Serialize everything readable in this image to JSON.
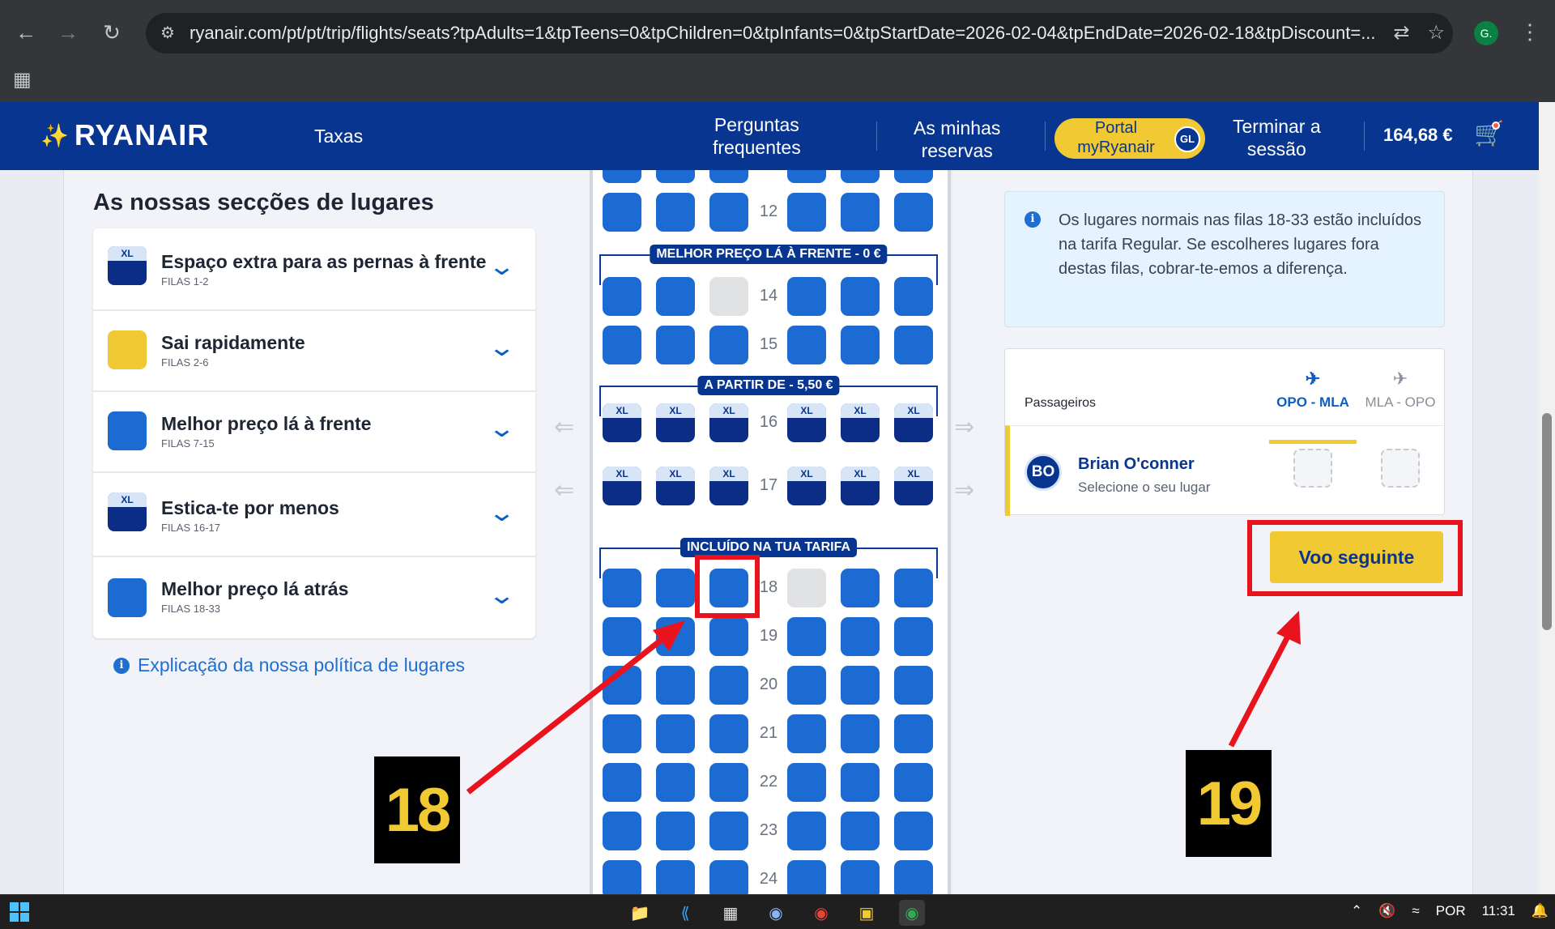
{
  "browser": {
    "url": "ryanair.com/pt/pt/trip/flights/seats?tpAdults=1&tpTeens=0&tpChildren=0&tpInfants=0&tpStartDate=2026-02-04&tpEndDate=2026-02-18&tpDiscount=...",
    "profile_initial": "G."
  },
  "header": {
    "logo": "RYANAIR",
    "taxes": "Taxas",
    "faq_line1": "Perguntas",
    "faq_line2": "frequentes",
    "bookings_line1": "As minhas",
    "bookings_line2": "reservas",
    "portal_line1": "Portal",
    "portal_line2": "myRyanair",
    "portal_badge": "GL",
    "logout_line1": "Terminar a",
    "logout_line2": "sessão",
    "total": "164,68 €"
  },
  "sections": {
    "title": "As nossas secções de lugares",
    "items": [
      {
        "name": "Espaço extra para as pernas à frente",
        "rows": "FILAS 1-2",
        "color": "#0c2d86",
        "badge": "XL"
      },
      {
        "name": "Sai rapidamente",
        "rows": "FILAS 2-6",
        "color": "#f1c933",
        "badge": ""
      },
      {
        "name": "Melhor preço lá à frente",
        "rows": "FILAS 7-15",
        "color": "#1b6bd2",
        "badge": ""
      },
      {
        "name": "Estica-te por menos",
        "rows": "FILAS 16-17",
        "color": "#0c2d86",
        "badge": "XL"
      },
      {
        "name": "Melhor preço lá atrás",
        "rows": "FILAS 18-33",
        "color": "#1b6bd2",
        "badge": ""
      }
    ],
    "policy_link": "Explicação da nossa política de lugares"
  },
  "seatmap": {
    "banners": {
      "front": "MELHOR PREÇO LÁ À FRENTE - 0 €",
      "xl": "A PARTIR DE - 5,50 €",
      "included": "INCLUÍDO NA TUA TARIFA"
    },
    "xl_label": "XL",
    "rows": [
      "12",
      "14",
      "15",
      "16",
      "17",
      "18",
      "19",
      "20",
      "21",
      "22",
      "23",
      "24"
    ]
  },
  "info": {
    "text": "Os lugares normais nas filas 18-33 estão incluídos na tarifa Regular. Se escolheres lugares fora destas filas, cobrar-te-emos a diferença."
  },
  "passengers": {
    "header": "Passageiros",
    "outbound": "OPO - MLA",
    "inbound": "MLA - OPO",
    "initials": "BO",
    "name": "Brian O'conner",
    "prompt": "Selecione o seu lugar"
  },
  "next_button": "Voo seguinte",
  "annotations": {
    "step_a": "18",
    "step_b": "19"
  },
  "taskbar": {
    "language": "POR",
    "time": "11:31"
  }
}
